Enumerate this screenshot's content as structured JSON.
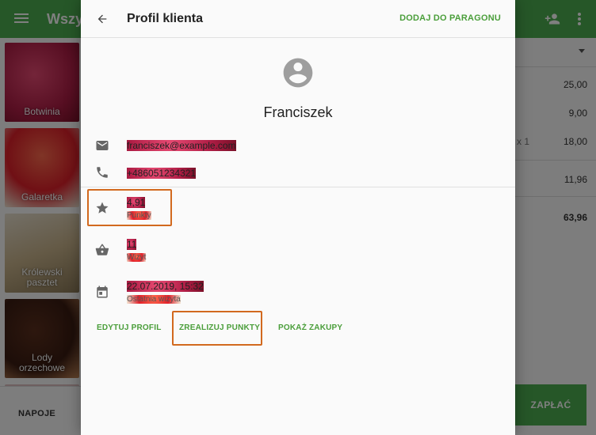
{
  "background": {
    "title": "Wszystkie",
    "tiles": [
      {
        "label": "Botwinia"
      },
      {
        "label": "Galaretka"
      },
      {
        "label": "Królewski pasztet"
      },
      {
        "label": "Lody orzechowe"
      }
    ],
    "bottom_tab": "NAPOJE",
    "receipt": {
      "qty": "x 1",
      "values": [
        "25,00",
        "9,00",
        "18,00",
        "11,96"
      ],
      "total": "63,96"
    },
    "pay_label": "ZAPŁAĆ"
  },
  "dialog": {
    "title": "Profil klienta",
    "add_label": "DODAJ DO PARAGONU",
    "name": "Franciszek",
    "email": "franciszek@example.com",
    "phone": "+486051234321",
    "points": {
      "value": "4,91",
      "label": "Punkty"
    },
    "visits": {
      "value": "11",
      "label": "Wizyt"
    },
    "last_visit": {
      "value": "22.07.2019, 15:32",
      "label": "Ostatnia wizyta"
    },
    "actions": {
      "edit": "EDYTUJ PROFIL",
      "redeem": "ZREALIZUJ PUNKTY",
      "purchases": "POKAŻ ZAKUPY"
    }
  },
  "colors": {
    "accent": "#4caf50",
    "action_text": "#4a9e3a",
    "highlight": "#d2691e"
  }
}
